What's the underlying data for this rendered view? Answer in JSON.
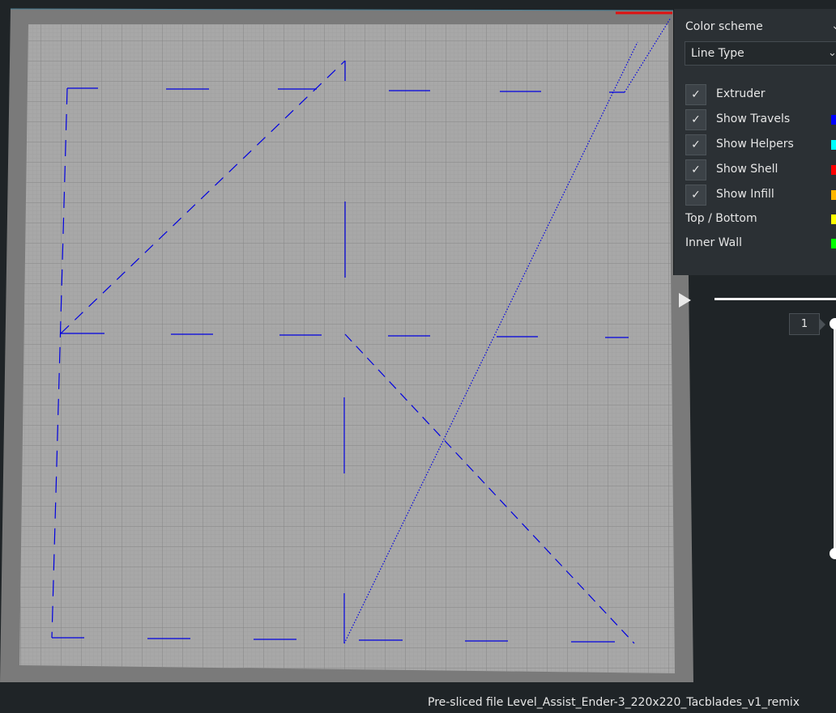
{
  "view": {
    "colors": {
      "background": "#1f2427",
      "bed_border": "#7a7a7a",
      "bed_surface": "#a6a6a6",
      "grid": "#8a8a8a",
      "travel": "#0000e0"
    }
  },
  "color_scheme": {
    "title": "Color scheme",
    "selected": "Line Type"
  },
  "checkboxes": [
    {
      "label": "Extruder",
      "checked": true,
      "color": ""
    },
    {
      "label": "Show Travels",
      "checked": true,
      "color": "#0000ff"
    },
    {
      "label": "Show Helpers",
      "checked": true,
      "color": "#00ffff"
    },
    {
      "label": "Show Shell",
      "checked": true,
      "color": "#ff0000"
    },
    {
      "label": "Show Infill",
      "checked": true,
      "color": "#ffb600"
    }
  ],
  "legend": [
    {
      "label": "Top / Bottom",
      "color": "#ffff00"
    },
    {
      "label": "Inner Wall",
      "color": "#00ff00"
    }
  ],
  "layer": {
    "current": "1"
  },
  "status": {
    "text": "Pre-sliced file Level_Assist_Ender-3_220x220_Tacblades_v1_remix"
  },
  "icons": {
    "check": "✓",
    "chevron": "⌄"
  }
}
